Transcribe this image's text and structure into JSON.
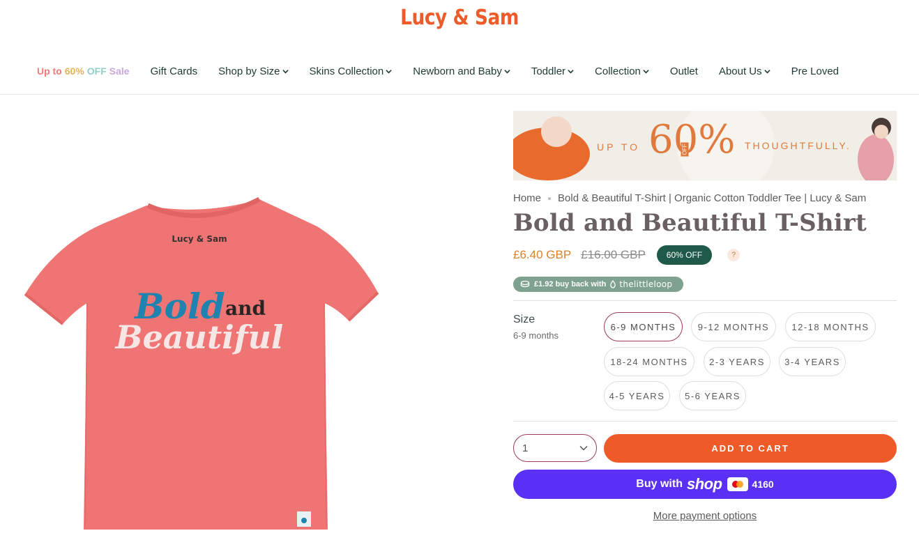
{
  "brand": {
    "logo_text": "Lucy & Sam",
    "accent_color": "#ef5a29"
  },
  "nav": {
    "sale": {
      "parts": [
        "Up to ",
        "60% ",
        "OFF ",
        "Sale"
      ]
    },
    "items": [
      {
        "label": "Gift Cards",
        "dropdown": false
      },
      {
        "label": "Shop by Size",
        "dropdown": true
      },
      {
        "label": "Skins Collection",
        "dropdown": true
      },
      {
        "label": "Newborn and Baby",
        "dropdown": true
      },
      {
        "label": "Toddler",
        "dropdown": true
      },
      {
        "label": "Collection",
        "dropdown": true
      },
      {
        "label": "Outlet",
        "dropdown": false
      },
      {
        "label": "About Us",
        "dropdown": true
      },
      {
        "label": "Pre Loved",
        "dropdown": false
      }
    ]
  },
  "product_image": {
    "tag_text": "Lucy & Sam",
    "print_line1": "Bold",
    "print_and": "and",
    "print_line2": "Beautiful"
  },
  "banner": {
    "up_to": "UP TO",
    "percent": "60%",
    "off": "OFF",
    "tagline": "THOUGHTFULLY."
  },
  "breadcrumb": {
    "home": "Home",
    "current": "Bold & Beautiful T-Shirt | Organic Cotton Toddler Tee | Lucy & Sam"
  },
  "product": {
    "title": "Bold and Beautiful T-Shirt",
    "price_sale": "£6.40 GBP",
    "price_original": "£16.00 GBP",
    "discount_badge": "60% OFF",
    "help_icon": "?"
  },
  "buyback": {
    "text": "£1.92 buy back with",
    "brand": "thelittleloop"
  },
  "size": {
    "label": "Size",
    "selected_value": "6-9 months",
    "options": [
      "6-9 MONTHS",
      "9-12 MONTHS",
      "12-18 MONTHS",
      "18-24 MONTHS",
      "2-3 YEARS",
      "3-4 YEARS",
      "4-5 YEARS",
      "5-6 YEARS"
    ]
  },
  "quantity": {
    "value": "1"
  },
  "actions": {
    "add_to_cart": "ADD TO CART",
    "shop_pay_prefix": "Buy with",
    "shop_pay_brand": "shop",
    "card_last4": "4160",
    "more_payment": "More payment options"
  }
}
